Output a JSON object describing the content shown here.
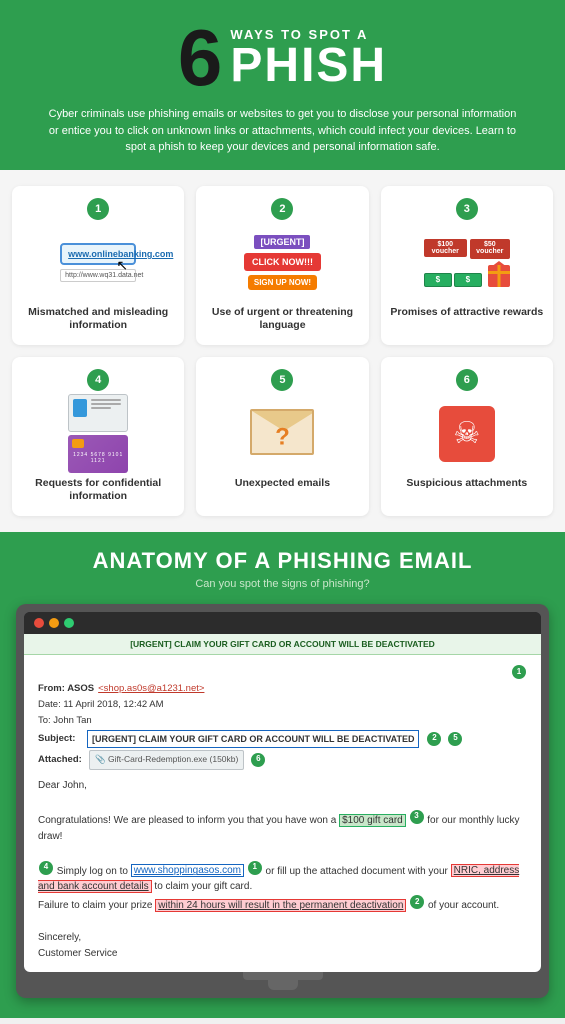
{
  "header": {
    "number": "6",
    "ways_to_spot": "WAYS TO SPOT A",
    "phish": "PHISH",
    "description": "Cyber criminals use phishing emails or websites to get you to disclose your personal information or entice you to click on unknown links or attachments, which could infect your devices. Learn to spot a phish to keep your devices and personal information safe."
  },
  "ways": [
    {
      "number": "1",
      "label": "Mismatched and misleading information",
      "icon": "browser"
    },
    {
      "number": "2",
      "label": "Use of urgent or threatening language",
      "icon": "urgent"
    },
    {
      "number": "3",
      "label": "Promises of attractive rewards",
      "icon": "rewards"
    },
    {
      "number": "4",
      "label": "Requests for confidential information",
      "icon": "card"
    },
    {
      "number": "5",
      "label": "Unexpected emails",
      "icon": "envelope"
    },
    {
      "number": "6",
      "label": "Suspicious attachments",
      "icon": "attachment"
    }
  ],
  "anatomy": {
    "title": "ANATOMY OF A PHISHING EMAIL",
    "subtitle": "Can you spot the signs of phishing?",
    "email": {
      "subject_bar": "[URGENT] CLAIM YOUR GIFT CARD OR ACCOUNT WILL BE DEACTIVATED",
      "from_label": "From: ASOS",
      "from_email": "<shop.as0s@a1231.net>",
      "date": "Date: 11 April 2018, 12:42 AM",
      "to": "To: John Tan",
      "subject_label": "Subject:",
      "subject_text": "[URGENT] CLAIM YOUR GIFT CARD OR ACCOUNT WILL BE DEACTIVATED",
      "attached_label": "Attached:",
      "attached_file": "Gift-Card-Redemption.exe (150kb)",
      "greeting": "Dear John,",
      "body1": "Congratulations! We are pleased to inform you that you have won a",
      "highlight1": "$100 gift card",
      "body1b": "for our monthly lucky draw!",
      "body2": "Simply log on to",
      "link1": "www.shoppingasos.com",
      "body2b": "or fill up the attached document with your",
      "highlight2": "NRIC, address and bank account details",
      "body2c": "to claim your gift card.",
      "body3": "Failure to claim your prize",
      "highlight3": "within 24 hours will result in the permanent deactivation",
      "body3b": "of your account.",
      "closing": "Sincerely,",
      "sender": "Customer Service"
    }
  }
}
